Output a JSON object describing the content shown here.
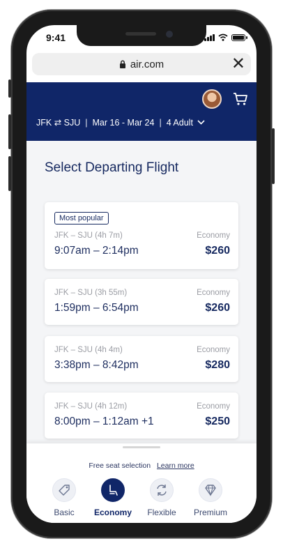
{
  "status": {
    "time": "9:41"
  },
  "browser": {
    "url": "air.com",
    "close_glyph": "✕"
  },
  "header": {
    "route": "JFK ⇄ SJU",
    "dates": "Mar 16 - Mar 24",
    "passengers": "4 Adult",
    "dropdown_icon": "chevron-down-icon"
  },
  "main": {
    "title": "Select Departing Flight",
    "flights": [
      {
        "badge": "Most popular",
        "route": "JFK – SJU (4h 7m)",
        "times": "9:07am – 2:14pm",
        "cabin": "Economy",
        "price": "$260"
      },
      {
        "route": "JFK – SJU  (3h 55m)",
        "times": "1:59pm – 6:54pm",
        "cabin": "Economy",
        "price": "$260"
      },
      {
        "route": "JFK – SJU (4h 4m)",
        "times": "3:38pm – 8:42pm",
        "cabin": "Economy",
        "price": "$280"
      },
      {
        "route": "JFK – SJU (4h 12m)",
        "times": "8:00pm – 1:12am +1",
        "cabin": "Economy",
        "price": "$250"
      }
    ]
  },
  "sheet": {
    "note": "Free seat selection",
    "link": "Learn more",
    "fares": [
      {
        "label": "Basic",
        "icon": "tag-icon",
        "selected": false
      },
      {
        "label": "Economy",
        "icon": "seat-icon",
        "selected": true
      },
      {
        "label": "Flexible",
        "icon": "swap-icon",
        "selected": false
      },
      {
        "label": "Premium",
        "icon": "diamond-icon",
        "selected": false
      }
    ]
  },
  "colors": {
    "navy": "#102668",
    "price": "#15285f",
    "muted": "#9a9ca3"
  }
}
